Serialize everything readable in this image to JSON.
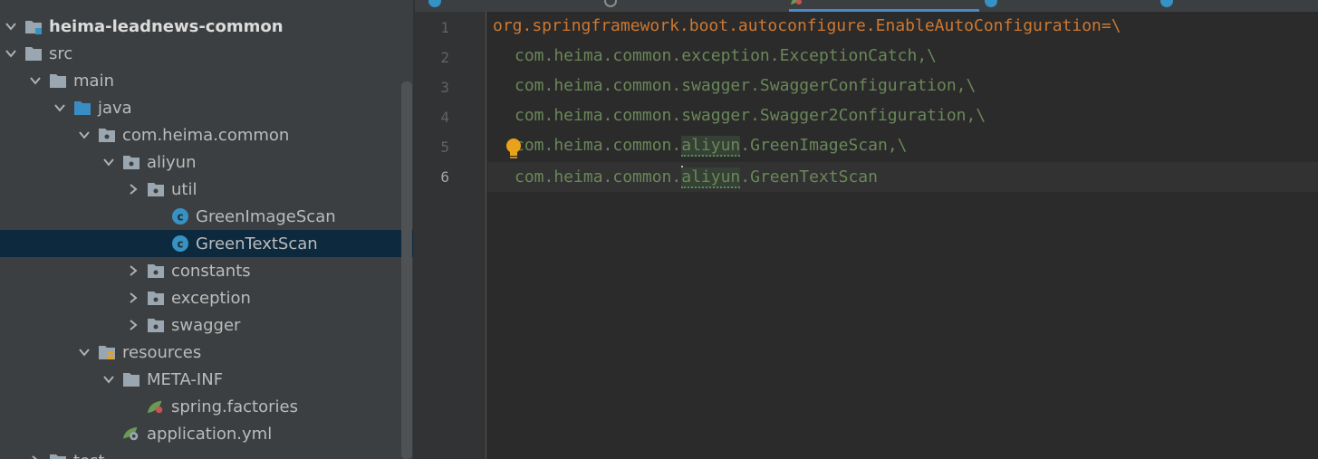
{
  "project_tree": {
    "nodes": [
      {
        "label": "heima-leadnews-common",
        "icon": "module-icon",
        "expanded": true,
        "selected": false
      },
      {
        "label": "src",
        "icon": "folder-icon",
        "expanded": true,
        "selected": false
      },
      {
        "label": "main",
        "icon": "folder-icon",
        "expanded": true,
        "selected": false
      },
      {
        "label": "java",
        "icon": "source-folder-icon",
        "expanded": true,
        "selected": false
      },
      {
        "label": "com.heima.common",
        "icon": "package-icon",
        "expanded": true,
        "selected": false
      },
      {
        "label": "aliyun",
        "icon": "package-icon",
        "expanded": true,
        "selected": false
      },
      {
        "label": "util",
        "icon": "package-icon",
        "expanded": false,
        "selected": false
      },
      {
        "label": "GreenImageScan",
        "icon": "class-icon",
        "expanded": null,
        "selected": false
      },
      {
        "label": "GreenTextScan",
        "icon": "class-icon",
        "expanded": null,
        "selected": true
      },
      {
        "label": "constants",
        "icon": "package-icon",
        "expanded": false,
        "selected": false
      },
      {
        "label": "exception",
        "icon": "package-icon",
        "expanded": false,
        "selected": false
      },
      {
        "label": "swagger",
        "icon": "package-icon",
        "expanded": false,
        "selected": false
      },
      {
        "label": "resources",
        "icon": "resources-folder-icon",
        "expanded": true,
        "selected": false
      },
      {
        "label": "META-INF",
        "icon": "folder-icon",
        "expanded": true,
        "selected": false
      },
      {
        "label": "spring.factories",
        "icon": "spring-file-icon",
        "expanded": null,
        "selected": false
      },
      {
        "label": "application.yml",
        "icon": "spring-config-icon",
        "expanded": null,
        "selected": false
      },
      {
        "label": "test",
        "icon": "folder-icon",
        "expanded": false,
        "selected": false
      }
    ]
  },
  "editor": {
    "current_line": 6,
    "lines": [
      {
        "num": "1",
        "key": "org.springframework.boot.autoconfigure.EnableAutoConfiguration",
        "sep": "=\\"
      },
      {
        "num": "2",
        "prefix": "com.heima.common.",
        "mid": "exception",
        "suffix": ".ExceptionCatch,\\"
      },
      {
        "num": "3",
        "prefix": "com.heima.common.",
        "mid": "swagger",
        "suffix": ".SwaggerConfiguration,\\"
      },
      {
        "num": "4",
        "prefix": "com.heima.common.",
        "mid": "swagger",
        "suffix": ".Swagger2Configuration,\\"
      },
      {
        "num": "5",
        "prefix": "com.heima.common.",
        "mid": "aliyun",
        "suffix": ".GreenImageScan,\\"
      },
      {
        "num": "6",
        "prefix": "com.heima.common.",
        "mid": "aliyun",
        "suffix": ".GreenTextScan"
      }
    ]
  },
  "colors": {
    "panel_bg": "#3c3f41",
    "editor_bg": "#2b2b2b",
    "selection": "#0d293e",
    "property_key": "#cc7832",
    "property_value": "#6a8759",
    "bulb": "#e9a31a",
    "active_tab_underline": "#4a88c7"
  }
}
